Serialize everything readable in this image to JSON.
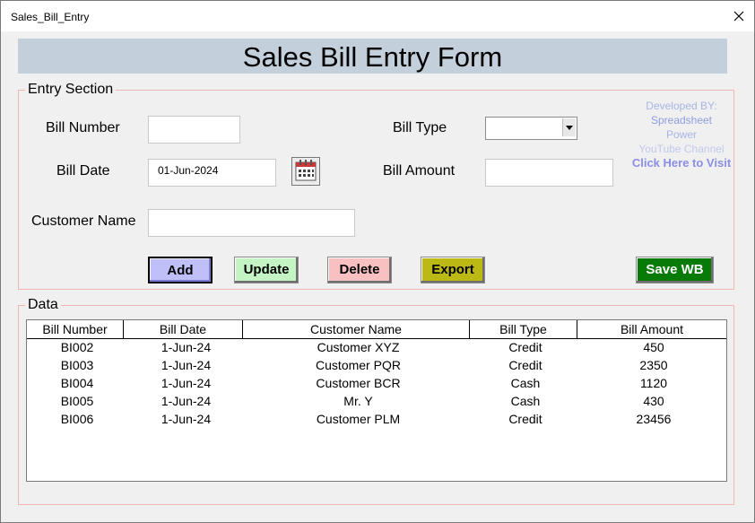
{
  "window": {
    "title": "Sales_Bill_Entry"
  },
  "banner": {
    "title": "Sales Bill Entry Form"
  },
  "entry_section": {
    "legend": "Entry Section",
    "bill_number_label": "Bill Number",
    "bill_number_value": "",
    "bill_date_label": "Bill Date",
    "bill_date_value": "01-Jun-2024",
    "customer_name_label": "Customer Name",
    "customer_name_value": "",
    "bill_type_label": "Bill Type",
    "bill_type_value": "",
    "bill_amount_label": "Bill Amount",
    "bill_amount_value": ""
  },
  "developer": {
    "line1": "Developed BY:",
    "line2": "Spreadsheet",
    "line3": "Power",
    "line4": "YouTube Channel",
    "link": "Click Here to Visit"
  },
  "buttons": {
    "add": "Add",
    "update": "Update",
    "delete": "Delete",
    "export": "Export",
    "save_wb": "Save WB"
  },
  "colors": {
    "add": "#c0c0f8",
    "update": "#c4f4c4",
    "delete": "#f8c0c0",
    "export": "#bcb814",
    "save_wb": "#087a08",
    "banner": "#c3cfdb",
    "frame_border": "#f1b6b2"
  },
  "data_section": {
    "legend": "Data",
    "columns": [
      "Bill Number",
      "Bill Date",
      "Customer Name",
      "Bill Type",
      "Bill Amount"
    ],
    "rows": [
      [
        "BI002",
        "1-Jun-24",
        "Customer XYZ",
        "Credit",
        "450"
      ],
      [
        "BI003",
        "1-Jun-24",
        "Customer PQR",
        "Credit",
        "2350"
      ],
      [
        "BI004",
        "1-Jun-24",
        "Customer BCR",
        "Cash",
        "1120"
      ],
      [
        "BI005",
        "1-Jun-24",
        "Mr. Y",
        "Cash",
        "430"
      ],
      [
        "BI006",
        "1-Jun-24",
        "Customer PLM",
        "Credit",
        "23456"
      ]
    ]
  }
}
